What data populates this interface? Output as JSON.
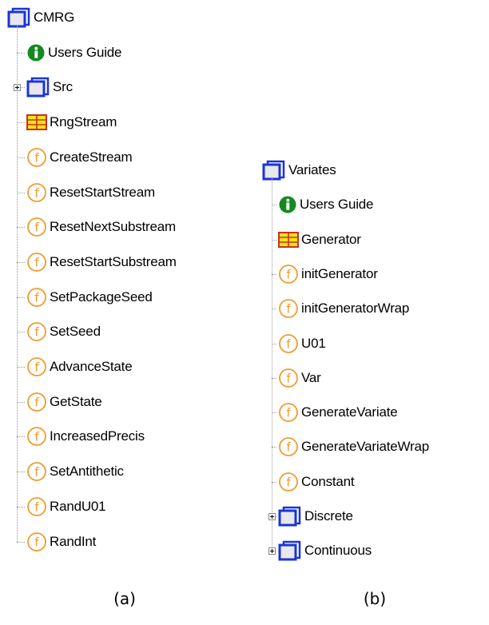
{
  "tree_a": {
    "root": "CMRG",
    "items": [
      {
        "label": "Users Guide",
        "icon": "info-icon"
      },
      {
        "label": "Src",
        "icon": "folder-icon",
        "expandable": true
      },
      {
        "label": "RngStream",
        "icon": "class-icon"
      },
      {
        "label": "CreateStream",
        "icon": "function-icon"
      },
      {
        "label": "ResetStartStream",
        "icon": "function-icon"
      },
      {
        "label": "ResetNextSubstream",
        "icon": "function-icon"
      },
      {
        "label": "ResetStartSubstream",
        "icon": "function-icon"
      },
      {
        "label": "SetPackageSeed",
        "icon": "function-icon"
      },
      {
        "label": "SetSeed",
        "icon": "function-icon"
      },
      {
        "label": "AdvanceState",
        "icon": "function-icon"
      },
      {
        "label": "GetState",
        "icon": "function-icon"
      },
      {
        "label": "IncreasedPrecis",
        "icon": "function-icon"
      },
      {
        "label": "SetAntithetic",
        "icon": "function-icon"
      },
      {
        "label": "RandU01",
        "icon": "function-icon"
      },
      {
        "label": "RandInt",
        "icon": "function-icon"
      }
    ],
    "caption": "(a)"
  },
  "tree_b": {
    "root": "Variates",
    "items": [
      {
        "label": "Users Guide",
        "icon": "info-icon"
      },
      {
        "label": "Generator",
        "icon": "class-icon"
      },
      {
        "label": "initGenerator",
        "icon": "function-icon"
      },
      {
        "label": "initGeneratorWrap",
        "icon": "function-icon"
      },
      {
        "label": "U01",
        "icon": "function-icon"
      },
      {
        "label": "Var",
        "icon": "function-icon"
      },
      {
        "label": "GenerateVariate",
        "icon": "function-icon"
      },
      {
        "label": "GenerateVariateWrap",
        "icon": "function-icon"
      },
      {
        "label": "Constant",
        "icon": "function-icon"
      },
      {
        "label": "Discrete",
        "icon": "folder-icon",
        "expandable": true
      },
      {
        "label": "Continuous",
        "icon": "folder-icon",
        "expandable": true
      }
    ],
    "caption": "(b)"
  },
  "colors": {
    "folder_blue": "#1a34d8",
    "info_green": "#148a1e",
    "function_orange": "#f29a2e",
    "class_yellow": "#f7e21a",
    "class_red": "#c8321e"
  }
}
